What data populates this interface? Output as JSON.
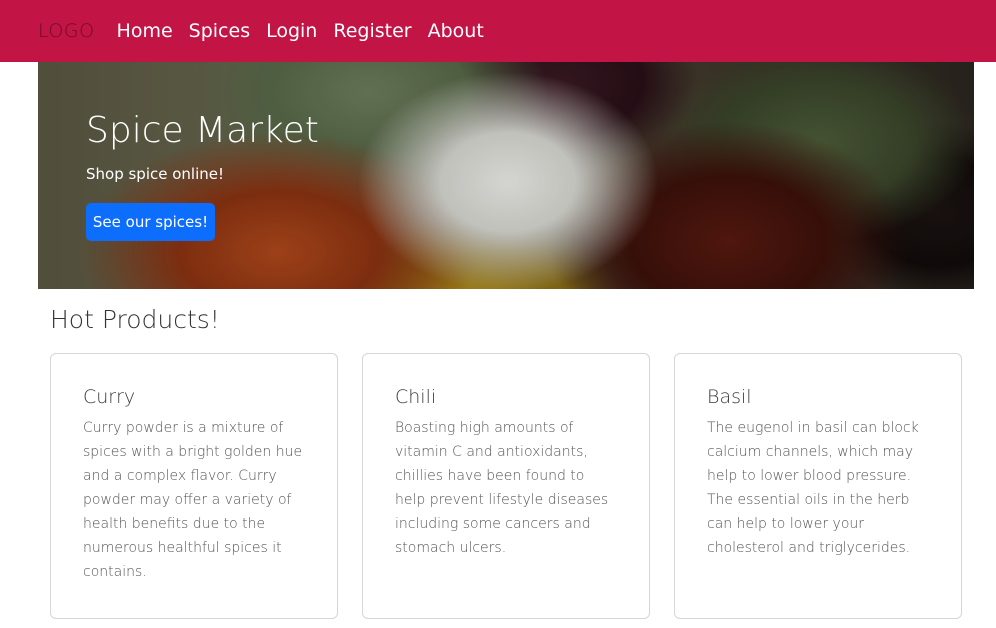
{
  "navbar": {
    "logo": "LOGO",
    "links": [
      "Home",
      "Spices",
      "Login",
      "Register",
      "About"
    ]
  },
  "hero": {
    "title": "Spice Market",
    "subtitle": "Shop spice online!",
    "button_label": "See our spices!"
  },
  "products": {
    "heading": "Hot Products!",
    "items": [
      {
        "title": "Curry",
        "text": "Curry powder is a mixture of spices with a bright golden hue and a complex flavor. Curry powder may offer a variety of health benefits due to the numerous healthful spices it contains."
      },
      {
        "title": "Chili",
        "text": "Boasting high amounts of vitamin C and antioxidants, chillies have been found to help prevent lifestyle diseases including some cancers and stomach ulcers."
      },
      {
        "title": "Basil",
        "text": "The eugenol in basil can block calcium channels, which may help to lower blood pressure. The essential oils in the herb can help to lower your cholesterol and triglycerides."
      }
    ]
  },
  "colors": {
    "navbar_bg": "#c21445",
    "button_bg": "#0d6efd"
  }
}
